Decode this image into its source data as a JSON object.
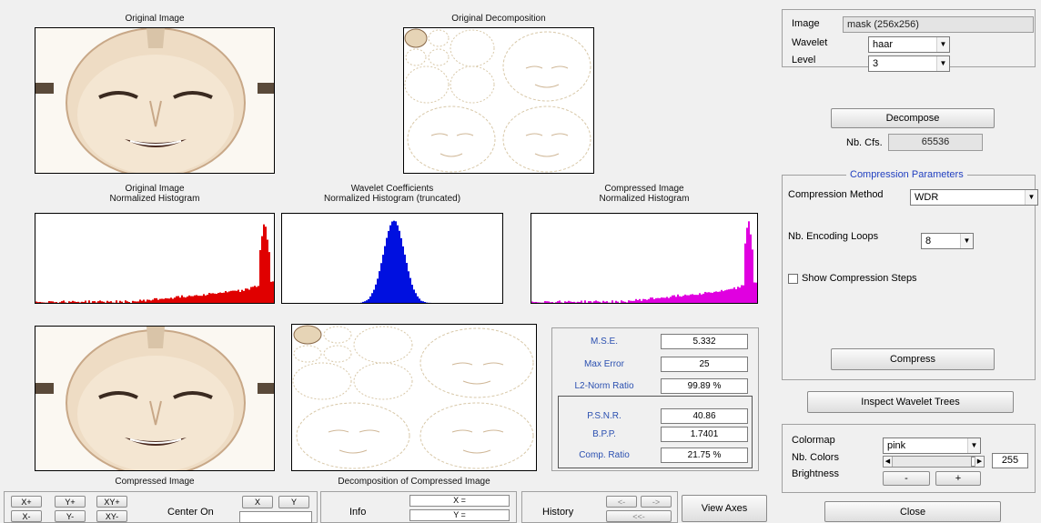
{
  "captions": {
    "original_image": "Original Image",
    "original_decomposition": "Original Decomposition",
    "orig_hist_line1": "Original Image",
    "orig_hist_line2": "Normalized Histogram",
    "wav_hist_line1": "Wavelet Coefficients",
    "wav_hist_line2": "Normalized Histogram (truncated)",
    "comp_hist_line1": "Compressed Image",
    "comp_hist_line2": "Normalized Histogram",
    "compressed_image": "Compressed Image",
    "decomposition_compressed": "Decomposition of Compressed Image"
  },
  "histograms": {
    "original": {
      "color": "#e00000",
      "type": "right-peak"
    },
    "wavelet": {
      "color": "#0010e0",
      "type": "center-peak"
    },
    "compressed": {
      "color": "#e000e0",
      "type": "right-peak"
    }
  },
  "metrics": [
    {
      "label": "M.S.E.",
      "value": "5.332"
    },
    {
      "label": "Max Error",
      "value": "25"
    },
    {
      "label": "L2-Norm Ratio",
      "value": "99.89 %"
    },
    {
      "label": "P.S.N.R.",
      "value": "40.86"
    },
    {
      "label": "B.P.P.",
      "value": "1.7401"
    },
    {
      "label": "Comp. Ratio",
      "value": "21.75 %"
    }
  ],
  "right_panel": {
    "image_label": "Image",
    "image_value": "mask  (256x256)",
    "wavelet_label": "Wavelet",
    "wavelet_value": "haar",
    "level_label": "Level",
    "level_value": "3",
    "decompose_label": "Decompose",
    "nbcfs_label": "Nb. Cfs.",
    "nbcfs_value": "65536",
    "compression_params_title": "Compression Parameters",
    "compression_method_label": "Compression Method",
    "compression_method_value": "WDR",
    "encoding_loops_label": "Nb. Encoding Loops",
    "encoding_loops_value": "8",
    "show_steps_label": "Show Compression Steps",
    "compress_label": "Compress",
    "inspect_label": "Inspect Wavelet Trees",
    "colormap_label": "Colormap",
    "colormap_value": "pink",
    "nb_colors_label": "Nb. Colors",
    "nb_colors_value": "255",
    "brightness_label": "Brightness",
    "brightness_minus": "-",
    "brightness_plus": "+",
    "close_label": "Close"
  },
  "toolbar": {
    "xplus": "X+",
    "yplus": "Y+",
    "xyplus": "XY+",
    "xminus": "X-",
    "yminus": "Y-",
    "xyminus": "XY-",
    "center_on_label": "Center On",
    "x_btn": "X",
    "y_btn": "Y",
    "info_label": "Info",
    "x_eq": "X =",
    "y_eq": "Y =",
    "history_label": "History",
    "hist_back": "<-",
    "hist_fwd": "->",
    "hist_start": "<<-",
    "view_axes_label": "View Axes"
  }
}
